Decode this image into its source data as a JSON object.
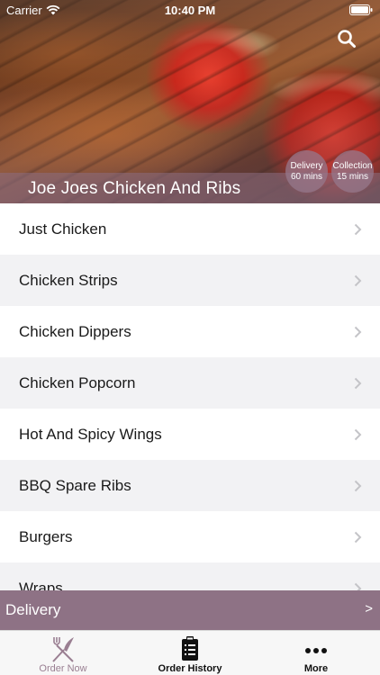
{
  "status_bar": {
    "carrier": "Carrier",
    "time": "10:40 PM",
    "wifi_icon": "wifi-icon",
    "battery_icon": "battery-icon"
  },
  "header": {
    "title": "Joe Joes Chicken And Ribs",
    "search_icon": "search-icon",
    "delivery": {
      "label": "Delivery",
      "time": "60 mins"
    },
    "collection": {
      "label": "Collection",
      "time": "15 mins"
    }
  },
  "categories": [
    {
      "label": "Just Chicken"
    },
    {
      "label": "Chicken Strips"
    },
    {
      "label": "Chicken Dippers"
    },
    {
      "label": "Chicken Popcorn"
    },
    {
      "label": "Hot And Spicy Wings"
    },
    {
      "label": "BBQ Spare Ribs"
    },
    {
      "label": "Burgers"
    },
    {
      "label": "Wraps"
    }
  ],
  "delivery_bar": {
    "label": "Delivery",
    "arrow": ">"
  },
  "tabs": [
    {
      "label": "Order Now",
      "icon": "fork-knife-icon"
    },
    {
      "label": "Order History",
      "icon": "clipboard-icon"
    },
    {
      "label": "More",
      "icon": "more-dots-icon"
    }
  ],
  "colors": {
    "accent": "#8e7285",
    "active_tab": "#9a7f92",
    "tab_bar_bg": "#f7f7f7",
    "row_alt": "#f2f2f4"
  }
}
